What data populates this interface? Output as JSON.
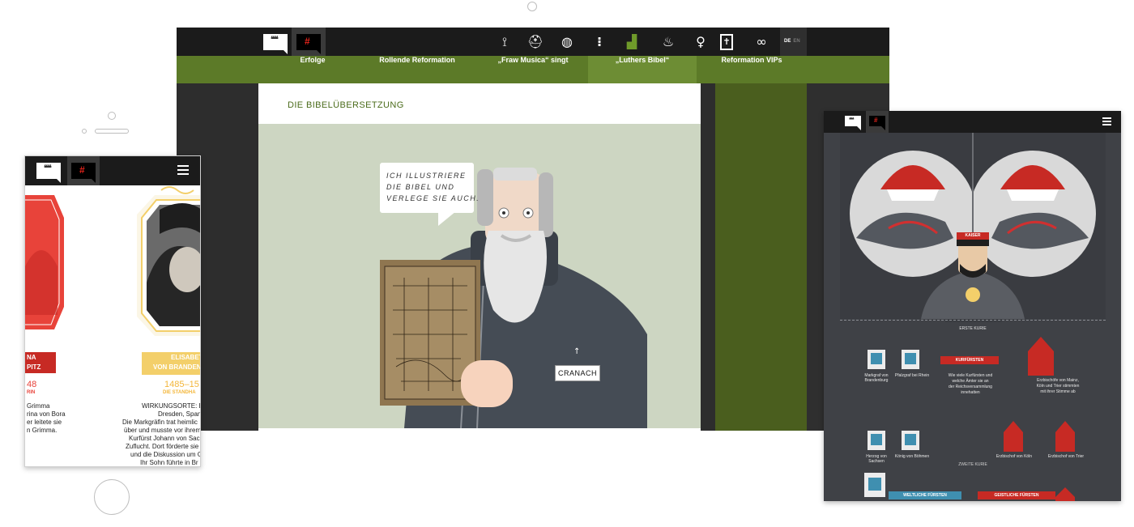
{
  "colors": {
    "accent_green": "#5c7a28",
    "accent_green_active": "#6d8d34",
    "brand_red": "#e3231b",
    "ribbon_red": "#c72a24",
    "ribbon_gold": "#f3cf6a",
    "topbar": "#1b1b1b",
    "scene_bg": "#cdd6c2"
  },
  "logos": {
    "quote_glyph": "❝❝",
    "hash_glyph": "#"
  },
  "desktop": {
    "nav_icons": [
      {
        "name": "route-icon",
        "glyph": "⟟"
      },
      {
        "name": "monk-figure-icon",
        "glyph": "⛑"
      },
      {
        "name": "globe-icon",
        "glyph": "◍"
      },
      {
        "name": "footsteps-icon",
        "glyph": "⁝"
      },
      {
        "name": "boot-icon",
        "glyph": "▟"
      },
      {
        "name": "fire-book-icon",
        "glyph": "♨"
      },
      {
        "name": "female-icon",
        "glyph": "♀"
      },
      {
        "name": "bible-icon",
        "glyph": "✝"
      },
      {
        "name": "fish-icon",
        "glyph": "∞"
      }
    ],
    "lang_de": "DE",
    "lang_en": "EN",
    "tabs": [
      {
        "label": "Erfolge",
        "active": false
      },
      {
        "label": "Rollende Reformation",
        "active": false
      },
      {
        "label": "„Fraw Musica“ singt",
        "active": false
      },
      {
        "label": "„Luthers Bibel“",
        "active": true
      },
      {
        "label": "Reformation VIPs",
        "active": false
      }
    ],
    "card_title": "DIE BIBELÜBERSETZUNG",
    "speech_lines": [
      "ICH ILLUSTRIERE",
      "DIE BIBEL UND",
      "VERLEGE SIE AUCH."
    ],
    "name_label": "CRANACH",
    "arrow_glyph": "↑"
  },
  "mobile": {
    "name_left_top": "NA",
    "name_left_bottom": "PITZ",
    "years_left": "48",
    "role_left": "RIN",
    "left_text": [
      "Grimma",
      "rina von Bora",
      "er leitete sie",
      "n Grimma."
    ],
    "name_right_top": "ELISABET",
    "name_right_bottom": "VON BRANDEN",
    "years_right": "1485–15",
    "role_right": "DIE STANDHA",
    "right_text": [
      "WIRKUNGSORTE: Bra",
      "Dresden, Span",
      "Die Markgräfin trat heimlic",
      "über und musste vor ihrem",
      "Kurfürst Johann von Sachs",
      "Zuflucht. Dort förderte sie",
      "und die Diskussion um G",
      "Ihr Sohn führte in Br"
    ]
  },
  "tablet": {
    "kaiser_label": "KAISER",
    "section_one": "ERSTE KURIE",
    "section_two": "ZWEITE KURIE",
    "kurfuersten_label": "KURFÜRSTEN",
    "kurfuersten_desc": [
      "Wie viele Kurfürsten und",
      "welche Ämter sie an",
      "der Reichsversammlung",
      "innehatten"
    ],
    "red_desc": [
      "Erzbischöfe von Mainz,",
      "Köln und Trier stimmten",
      "mit ihrer Stimme ab"
    ],
    "tile_labels_row1": [
      "Markgraf von Brandenburg",
      "Pfalzgraf bei Rhein"
    ],
    "tile_labels_row2": [
      "Herzog von Sachsen",
      "König von Böhmen"
    ],
    "red_labels_row2": [
      "Erzbischof von Köln",
      "Erzbischof von Trier"
    ],
    "bottom_left": "WELTLICHE FÜRSTEN",
    "bottom_right": "GEISTLICHE FÜRSTEN"
  }
}
